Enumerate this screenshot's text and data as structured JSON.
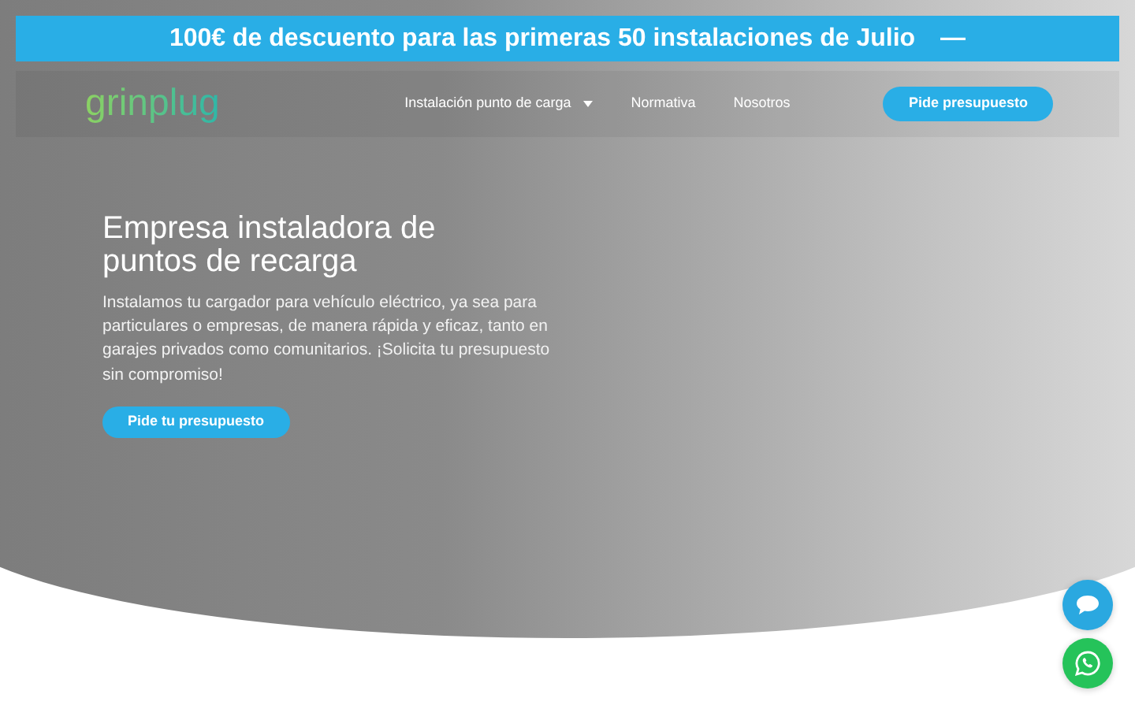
{
  "promo_banner": {
    "text": "100€ de descuento para las primeras 50 instalaciones de Julio",
    "toggle": "—"
  },
  "navbar": {
    "logo": "grinplug",
    "links": [
      {
        "label": "Instalación punto de carga",
        "dropdown": true
      },
      {
        "label": "Normativa",
        "dropdown": false
      },
      {
        "label": "Nosotros",
        "dropdown": false
      }
    ],
    "cta": "Pide presupuesto"
  },
  "hero": {
    "title": "Empresa instaladora de puntos de recarga",
    "text": "Instalamos tu cargador para vehículo eléctrico, ya sea para particulares o empresas, de manera rápida y eficaz, tanto en garajes privados como comunitarios. ¡Solicita tu presupuesto sin compromiso!",
    "button": "Pide tu presupuesto"
  },
  "floating_buttons": [
    {
      "kind": "chat",
      "color": "#2aa8e0"
    },
    {
      "kind": "whatsapp",
      "color": "#25c35a"
    }
  ]
}
